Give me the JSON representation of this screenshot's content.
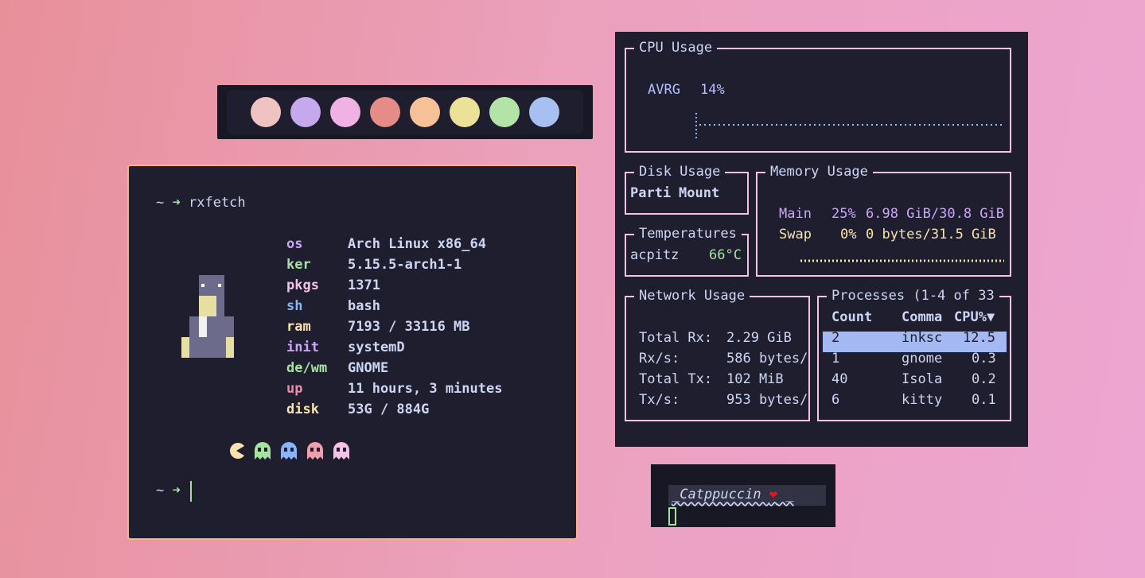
{
  "palette": {
    "colors": [
      "#eec3c1",
      "#c6a8ec",
      "#f0b2e2",
      "#e58c88",
      "#f7c197",
      "#ebe199",
      "#b3e3a6",
      "#a7c0f2"
    ]
  },
  "fetch": {
    "prompt_symbol": "~",
    "arrow_icon": "➜",
    "command": "rxfetch",
    "fields": [
      {
        "key": "os",
        "value": "Arch Linux x86_64",
        "color": "#cba6f7"
      },
      {
        "key": "ker",
        "value": "5.15.5-arch1-1",
        "color": "#a6e3a1"
      },
      {
        "key": "pkgs",
        "value": "1371",
        "color": "#f5c2e7"
      },
      {
        "key": "sh",
        "value": "bash",
        "color": "#89b4fa"
      },
      {
        "key": "ram",
        "value": "7193 / 33116 MB",
        "color": "#f9e2af"
      },
      {
        "key": "init",
        "value": "systemD",
        "color": "#cba6f7"
      },
      {
        "key": "de/wm",
        "value": "GNOME",
        "color": "#a6e3a1"
      },
      {
        "key": "up",
        "value": "11 hours, 3 minutes",
        "color": "#f38ba8"
      },
      {
        "key": "disk",
        "value": "53G / 884G",
        "color": "#f9e2af"
      }
    ],
    "pacman_icons": [
      "pacman-icon",
      "ghost-green-icon",
      "ghost-blue-icon",
      "ghost-red-icon",
      "ghost-pink-icon"
    ]
  },
  "btop": {
    "cpu": {
      "title": "CPU Usage",
      "label": "AVRG",
      "value": "14%"
    },
    "disk": {
      "title": "Disk Usage",
      "col1": "Parti",
      "col2": "Mount"
    },
    "memory": {
      "title": "Memory Usage",
      "main_label": "Main",
      "main_pct": "25%",
      "main_val": "6.98 GiB/30.8 GiB",
      "swap_label": "Swap",
      "swap_pct": "0%",
      "swap_val": "0 bytes/31.5 GiB"
    },
    "temps": {
      "title": "Temperatures",
      "sensor": "acpitz",
      "value": "66°C"
    },
    "network": {
      "title": "Network Usage",
      "rows": [
        {
          "label": "Total Rx:",
          "value": "2.29 GiB"
        },
        {
          "label": "Rx/s:",
          "value": "586 bytes/"
        },
        {
          "label": "Total Tx:",
          "value": "102 MiB"
        },
        {
          "label": "Tx/s:",
          "value": "953 bytes/"
        }
      ]
    },
    "processes": {
      "title": "Processes (1-4 of 33",
      "headers": [
        "Count",
        "Comma",
        "CPU%▼"
      ],
      "rows": [
        {
          "count": "2",
          "command": "inksc",
          "cpu": "12.5"
        },
        {
          "count": "1",
          "command": "gnome",
          "cpu": "0.3"
        },
        {
          "count": "40",
          "command": "Isola",
          "cpu": "0.2"
        },
        {
          "count": "6",
          "command": "kitty",
          "cpu": "0.1"
        }
      ]
    }
  },
  "catppuccin": {
    "text": "_Catppuccin ❤ _"
  }
}
